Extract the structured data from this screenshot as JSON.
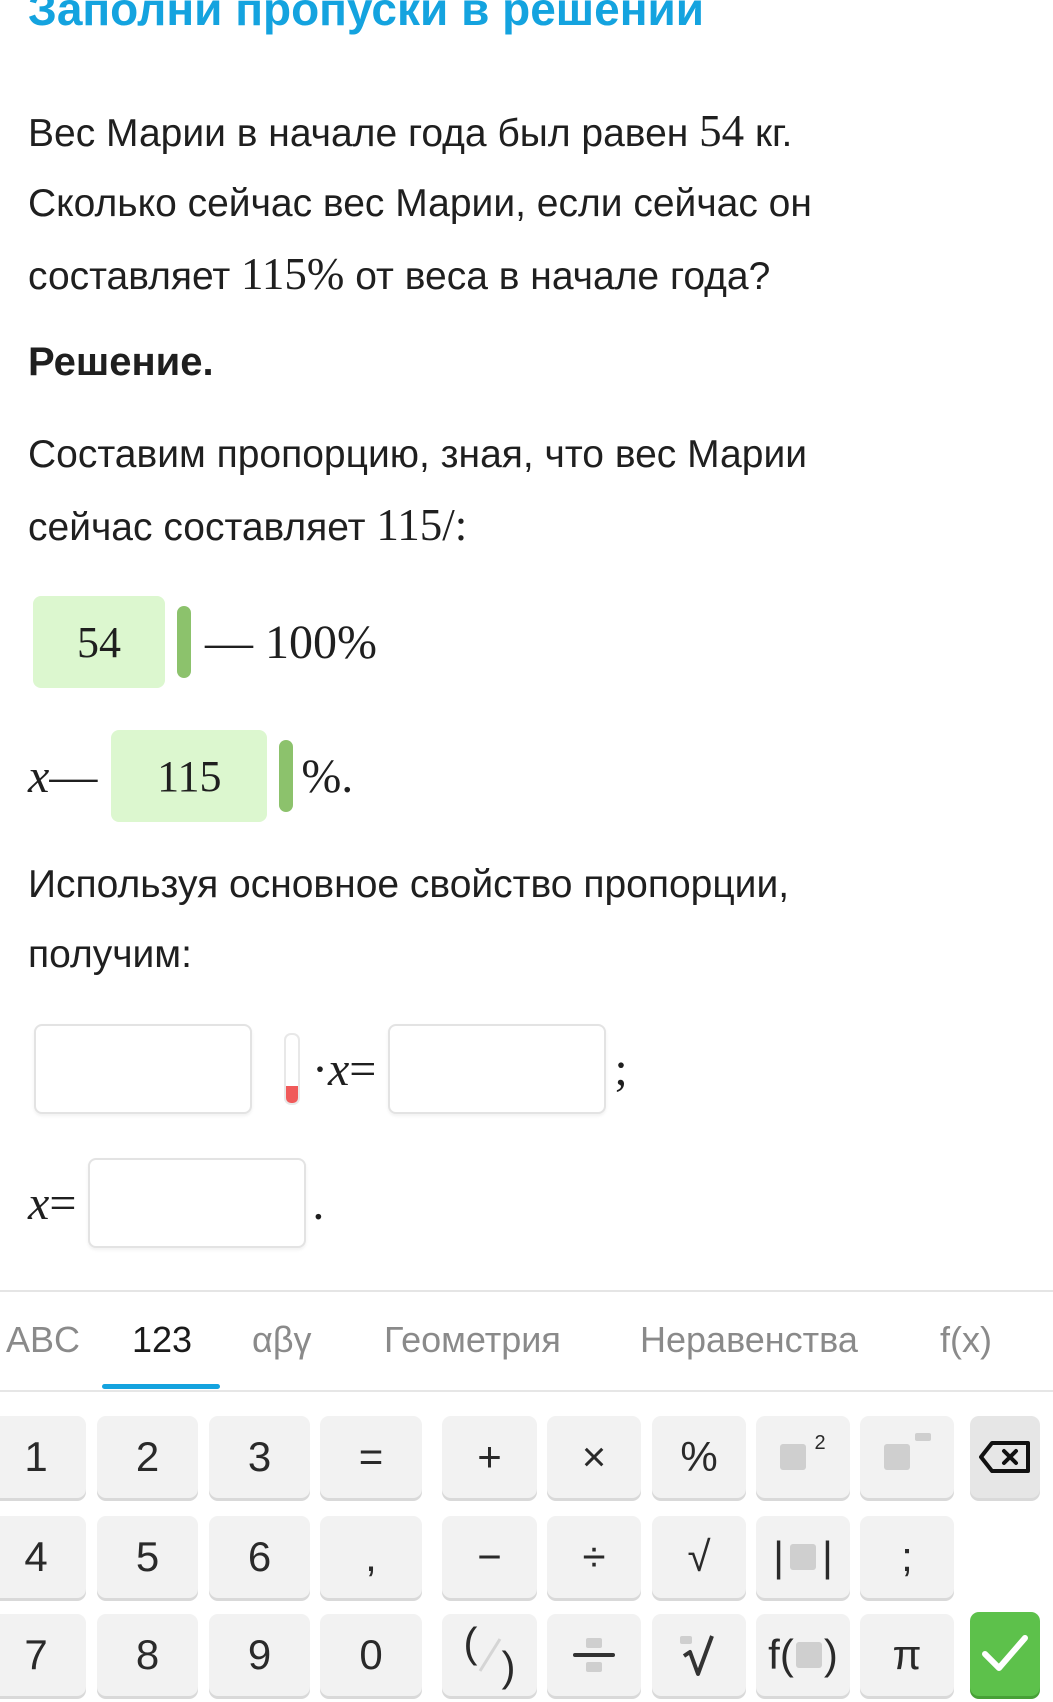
{
  "task": {
    "heading": "Заполни пропуски в решении",
    "problem": {
      "line1_pre": "Вес Марии в начале года был равен ",
      "line1_num": "54",
      "line1_post": " кг.",
      "line2": "Сколько сейчас вес Марии, если сейчас он",
      "line3_pre": "составляет ",
      "line3_num": "115%",
      "line3_post": " от веса в начале года?"
    },
    "solution_title": "Решение.",
    "step1": {
      "text_line1": "Составим пропорцию, зная, что вес Марии",
      "text_line2_pre": "сейчас составляет ",
      "text_line2_math": "115/:"
    },
    "proportion": {
      "row1_answer": "54",
      "row1_tail": "— 100%",
      "row2_var": "x",
      "row2_dash": " —",
      "row2_answer": "115",
      "row2_tail": "%."
    },
    "step2": {
      "text_line1": "Используя основное свойство пропорции,",
      "text_line2": "получим:"
    },
    "equation": {
      "input1": "",
      "mult": "·",
      "var": "x",
      "eq": " =",
      "input2": "",
      "end": ";"
    },
    "result": {
      "var": "x",
      "eq": " =",
      "input": "",
      "end": "."
    }
  },
  "keyboard": {
    "tabs": [
      {
        "label": "ABC"
      },
      {
        "label": "123"
      },
      {
        "label": "αβγ"
      },
      {
        "label": "Геометрия"
      },
      {
        "label": "Неравенства"
      },
      {
        "label": "f(x)"
      }
    ],
    "active_tab": "123",
    "row1": [
      "1",
      "2",
      "3",
      "=",
      "+",
      "×",
      "%"
    ],
    "row2": [
      "4",
      "5",
      "6",
      ",",
      "−",
      "÷",
      "√",
      ";"
    ],
    "row3": [
      "7",
      "8",
      "9",
      "0",
      "π"
    ],
    "square_exponent": "2",
    "abs_bars": "|",
    "func_prefix": "f(",
    "func_suffix": ")",
    "paren_open": "(",
    "paren_close": ")",
    "check_mark": "✓",
    "colors": {
      "accent": "#14a3df",
      "answer_fill": "#dcf7cf",
      "correct_marker": "#8cc26c",
      "active_marker": "#f05a5a",
      "enter_key": "#5dc14b"
    }
  }
}
